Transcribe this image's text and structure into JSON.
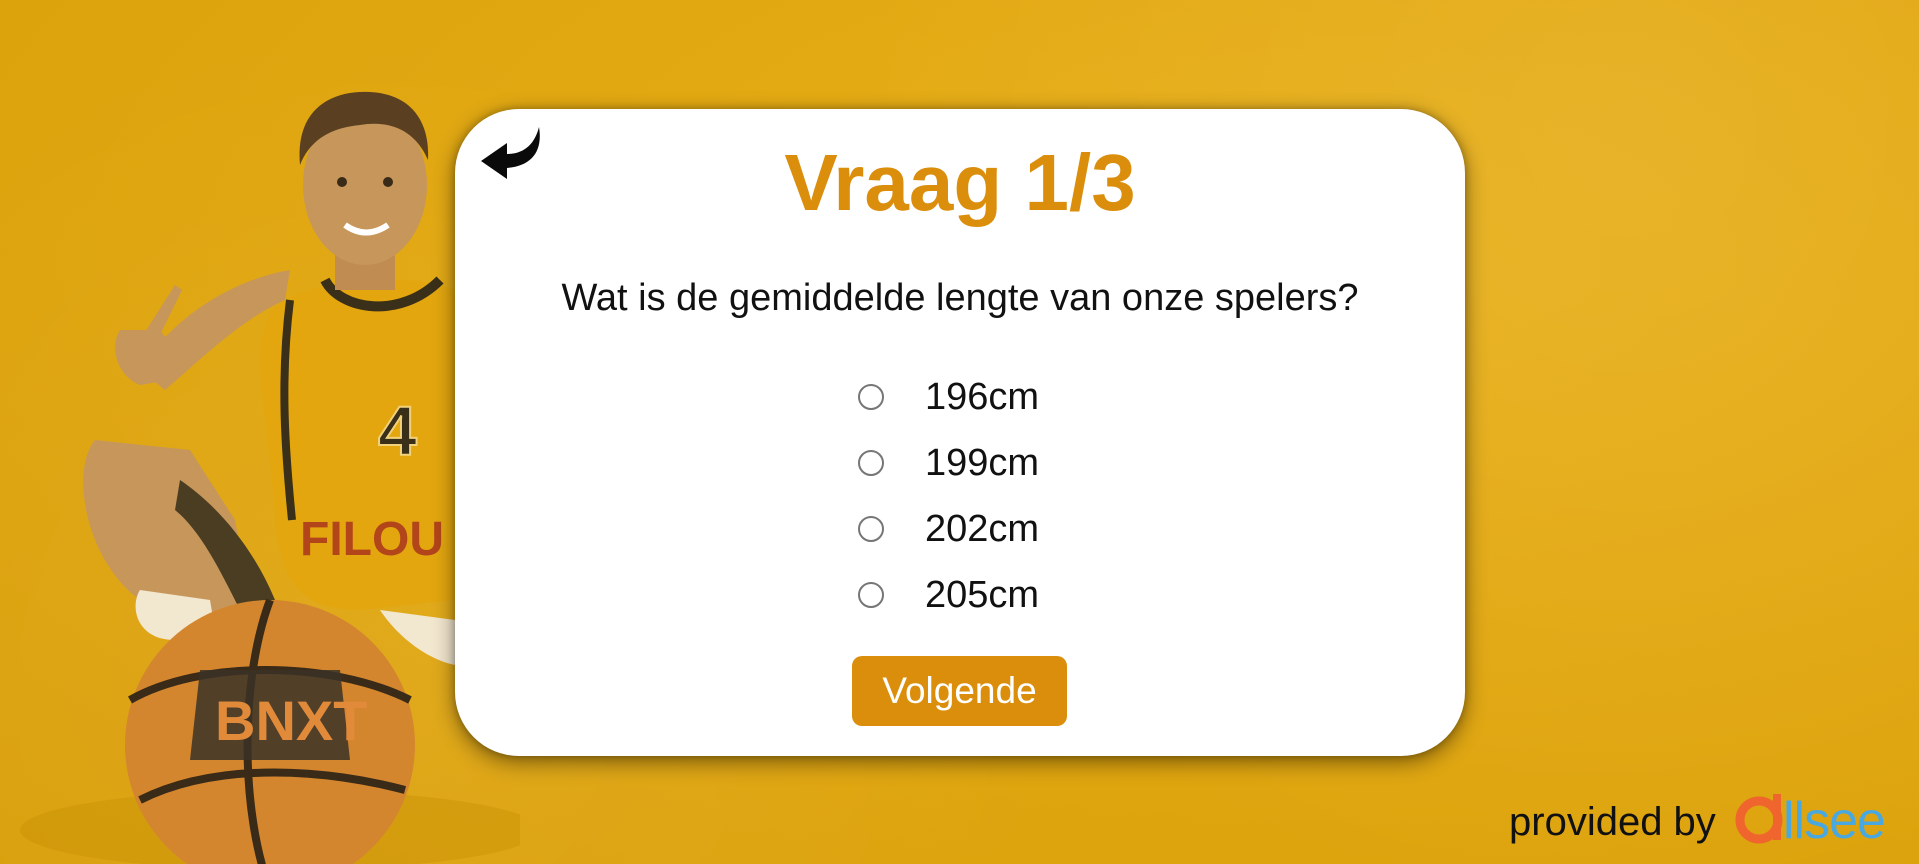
{
  "quiz": {
    "title": "Vraag 1/3",
    "question": "Wat is de gemiddelde lengte van onze spelers?",
    "options": [
      {
        "label": "196cm",
        "selected": false
      },
      {
        "label": "199cm",
        "selected": false
      },
      {
        "label": "202cm",
        "selected": false
      },
      {
        "label": "205cm",
        "selected": false
      }
    ],
    "next_label": "Volgende"
  },
  "footer": {
    "provided_by": "provided by",
    "brand_name": "allsee"
  },
  "player": {
    "jersey_number": "4",
    "jersey_text": "FILOU",
    "ball_text": "BNXT"
  },
  "colors": {
    "accent": "#db8e0c",
    "background": "#e2a811",
    "brand_orange": "#f0642d",
    "brand_blue": "#4aa8e0"
  },
  "icons": {
    "back": "back-arrow-icon",
    "logo": "allsee-logo"
  }
}
